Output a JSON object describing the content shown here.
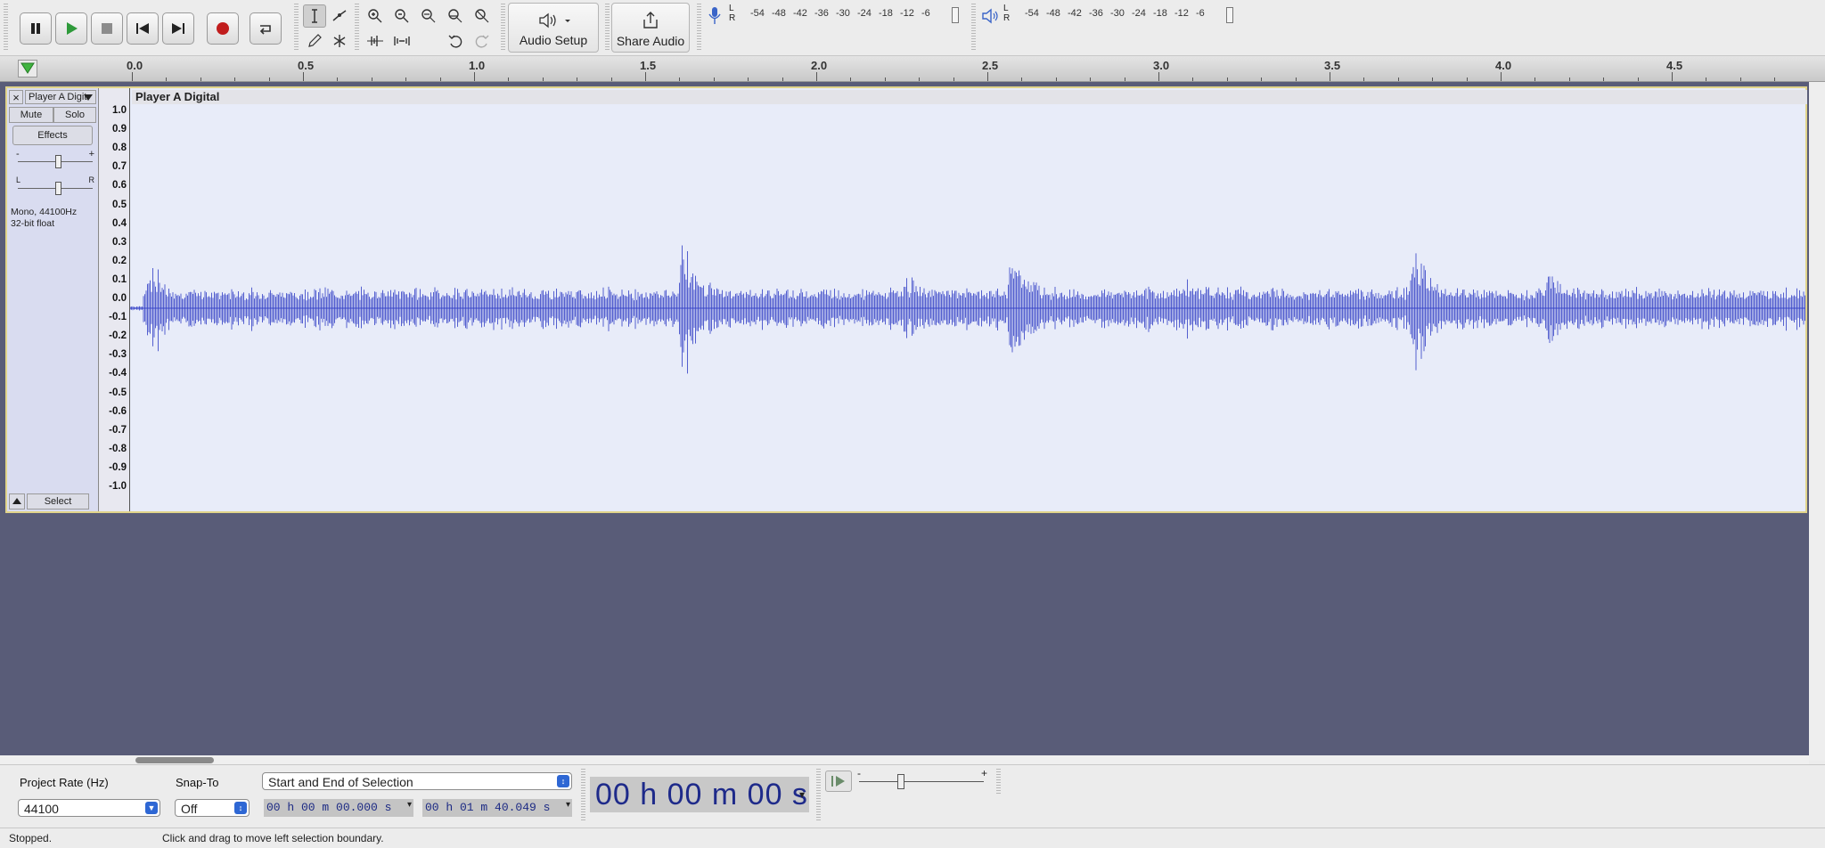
{
  "toolbar": {
    "audio_setup_label": "Audio Setup",
    "share_audio_label": "Share Audio",
    "meter_ticks": [
      "-54",
      "-48",
      "-42",
      "-36",
      "-30",
      "-24",
      "-18",
      "-12",
      "-6"
    ],
    "meter_lr": [
      "L",
      "R"
    ]
  },
  "ruler": {
    "labels": [
      "0.0",
      "0.5",
      "1.0",
      "1.5",
      "2.0",
      "2.5",
      "3.0",
      "3.5",
      "4.0",
      "4.5"
    ]
  },
  "track": {
    "name_button": "Player A Digit",
    "close_label": "×",
    "mute_label": "Mute",
    "solo_label": "Solo",
    "effects_label": "Effects",
    "gain_minus": "-",
    "gain_plus": "+",
    "pan_left": "L",
    "pan_right": "R",
    "format_line1": "Mono, 44100Hz",
    "format_line2": "32-bit float",
    "select_label": "Select",
    "clip_title": "Player A Digital",
    "vertical_scale": [
      "1.0",
      "0.9",
      "0.8",
      "0.7",
      "0.6",
      "0.5",
      "0.4",
      "0.3",
      "0.2",
      "0.1",
      "0.0",
      "-0.1",
      "-0.2",
      "-0.3",
      "-0.4",
      "-0.5",
      "-0.6",
      "-0.7",
      "-0.8",
      "-0.9",
      "-1.0"
    ],
    "waveform_color": "#3a47c8"
  },
  "bottom": {
    "project_rate_label": "Project Rate (Hz)",
    "project_rate_value": "44100",
    "snap_to_label": "Snap-To",
    "snap_to_value": "Off",
    "selection_mode": "Start and End of Selection",
    "selection_start": "00 h 00 m 00.000 s",
    "selection_end": "00 h 01 m 40.049 s",
    "time_display": "00 h 00 m 00 s",
    "play_speed_minus": "-",
    "play_speed_plus": "+"
  },
  "status": {
    "state": "Stopped.",
    "hint": "Click and drag to move left selection boundary."
  }
}
